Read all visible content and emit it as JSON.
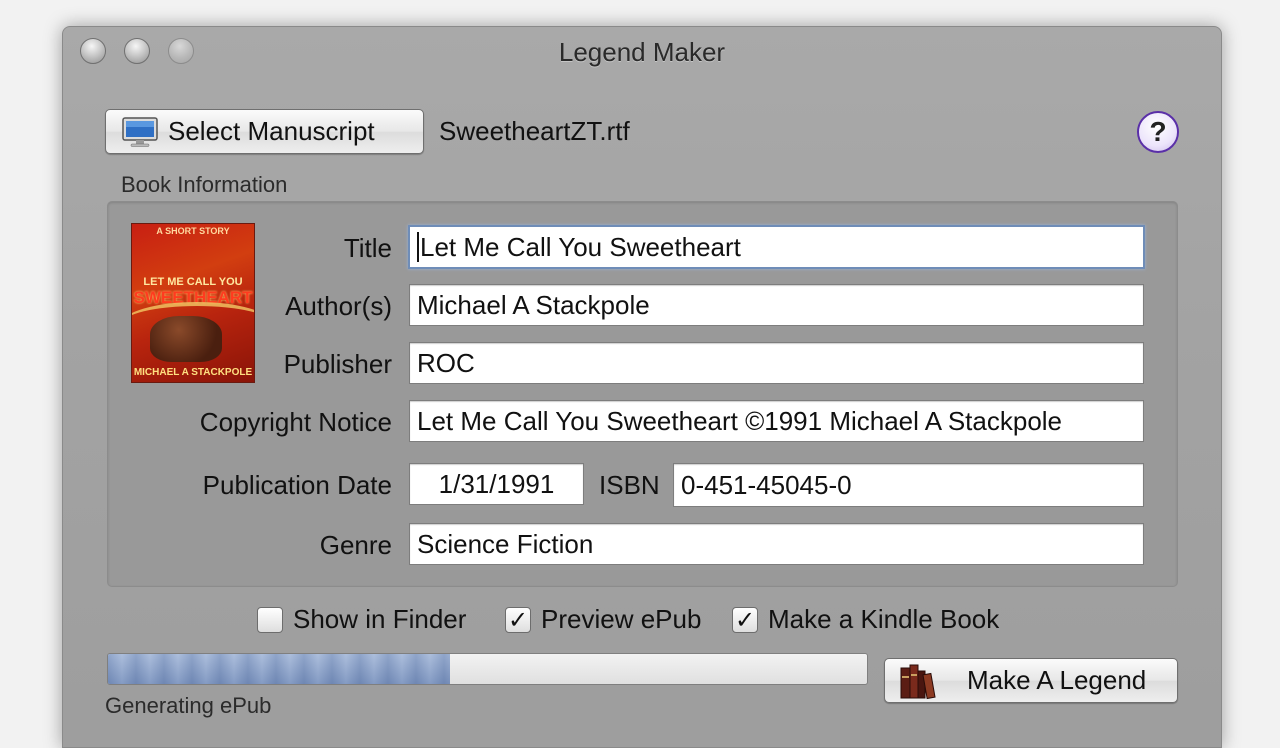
{
  "window": {
    "title": "Legend Maker"
  },
  "toolbar": {
    "select_label": "Select Manuscript",
    "filename": "SweetheartZT.rtf",
    "help_label": "?"
  },
  "book_info": {
    "group_title": "Book Information",
    "cover_art": {
      "kicker": "A SHORT STORY",
      "title_line1": "LET ME CALL YOU",
      "title_line2": "SWEETHEART",
      "author": "MICHAEL A STACKPOLE"
    },
    "title": {
      "label": "Title",
      "value": "Let Me Call You Sweetheart"
    },
    "authors": {
      "label": "Author(s)",
      "value": "Michael A Stackpole"
    },
    "publisher": {
      "label": "Publisher",
      "value": "ROC"
    },
    "copyright": {
      "label": "Copyright Notice",
      "value": "Let Me Call You Sweetheart ©1991 Michael A Stackpole"
    },
    "pub_date": {
      "label": "Publication Date",
      "value": "1/31/1991"
    },
    "isbn": {
      "label": "ISBN",
      "value": "0-451-45045-0"
    },
    "genre": {
      "label": "Genre",
      "value": "Science Fiction"
    }
  },
  "options": {
    "show_in_finder": {
      "label": "Show in Finder",
      "checked": false
    },
    "preview_epub": {
      "label": "Preview ePub",
      "checked": true
    },
    "make_kindle": {
      "label": "Make a Kindle Book",
      "checked": true
    }
  },
  "progress": {
    "fraction": 0.45,
    "status": "Generating ePub"
  },
  "actions": {
    "make_legend_label": "Make A Legend"
  },
  "colors": {
    "help_accent": "#5a2fa8",
    "focus_ring": "#6f8db8",
    "cover_red": "#c81f12"
  },
  "icons": {
    "select": "monitor-icon",
    "make": "books-icon",
    "help": "help-icon"
  }
}
